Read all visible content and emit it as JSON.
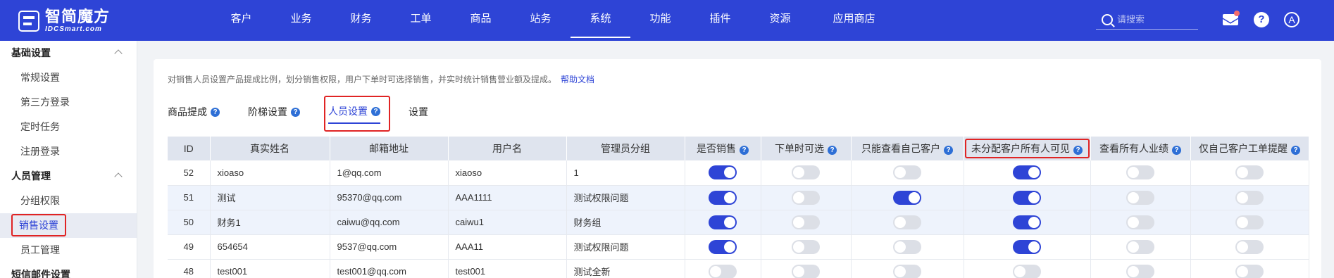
{
  "app": {
    "logo_cn": "智简魔方",
    "logo_en": "IDCSmart.com"
  },
  "nav": [
    {
      "label": "客户"
    },
    {
      "label": "业务"
    },
    {
      "label": "财务"
    },
    {
      "label": "工单"
    },
    {
      "label": "商品"
    },
    {
      "label": "站务"
    },
    {
      "label": "系统",
      "active": true
    },
    {
      "label": "功能"
    },
    {
      "label": "插件"
    },
    {
      "label": "资源"
    },
    {
      "label": "应用商店"
    }
  ],
  "search": {
    "placeholder": "请搜索"
  },
  "header_icons": {
    "mail": "mail-icon",
    "help": "?",
    "avatar": "A"
  },
  "sidebar": {
    "group1": {
      "label": "基础设置",
      "items": [
        "常规设置",
        "第三方登录",
        "定时任务",
        "注册登录"
      ]
    },
    "group2": {
      "label": "人员管理",
      "items": [
        "分组权限",
        "销售设置",
        "员工管理"
      ]
    },
    "group3": {
      "label": "短信邮件设置"
    },
    "active_item": "销售设置"
  },
  "main": {
    "description": "对销售人员设置产品提成比例，划分销售权限，用户下单时可选择销售，并实时统计销售营业额及提成。",
    "help_link": "帮助文档",
    "tabs": [
      {
        "label": "商品提成",
        "help": true
      },
      {
        "label": "阶梯设置",
        "help": true
      },
      {
        "label": "人员设置",
        "help": true,
        "active": true
      },
      {
        "label": "设置",
        "help": false
      }
    ]
  },
  "table": {
    "columns": [
      "ID",
      "真实姓名",
      "邮箱地址",
      "用户名",
      "管理员分组",
      "是否销售",
      "下单时可选",
      "只能查看自己客户",
      "未分配客户所有人可见",
      "查看所有人业绩",
      "仅自己客户工单提醒"
    ],
    "rows": [
      {
        "id": "52",
        "name": "xioaso",
        "email": "1@qq.com",
        "username": "xiaoso",
        "group": "1",
        "switches": [
          true,
          false,
          false,
          true,
          false,
          false
        ]
      },
      {
        "id": "51",
        "name": "测试",
        "email": "95370@qq.com",
        "username": "AAA1111",
        "group": "测试权限问题",
        "switches": [
          true,
          false,
          true,
          true,
          false,
          false
        ]
      },
      {
        "id": "50",
        "name": "财务1",
        "email": "caiwu@qq.com",
        "username": "caiwu1",
        "group": "财务组",
        "switches": [
          true,
          false,
          false,
          true,
          false,
          false
        ]
      },
      {
        "id": "49",
        "name": "654654",
        "email": "9537@qq.com",
        "username": "AAA11",
        "group": "测试权限问题",
        "switches": [
          true,
          false,
          false,
          true,
          false,
          false
        ]
      },
      {
        "id": "48",
        "name": "test001",
        "email": "test001@qq.com",
        "username": "test001",
        "group": "测试全新",
        "switches": [
          false,
          false,
          false,
          false,
          false,
          false
        ]
      }
    ]
  }
}
